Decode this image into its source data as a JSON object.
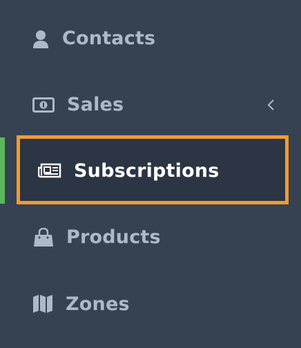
{
  "sidebar": {
    "items": [
      {
        "label": "Contacts",
        "icon": "user-icon"
      },
      {
        "label": "Sales",
        "icon": "money-icon",
        "has_submenu": true
      },
      {
        "label": "Subscriptions",
        "icon": "newspaper-icon",
        "active": true
      },
      {
        "label": "Products",
        "icon": "shopping-bag-icon"
      },
      {
        "label": "Zones",
        "icon": "map-icon"
      }
    ]
  },
  "colors": {
    "background": "#364252",
    "active_background": "#2b3544",
    "active_indicator": "#5cb85c",
    "highlight_border": "#f39a32",
    "text": "#aeb9c8",
    "active_text": "#ffffff"
  }
}
